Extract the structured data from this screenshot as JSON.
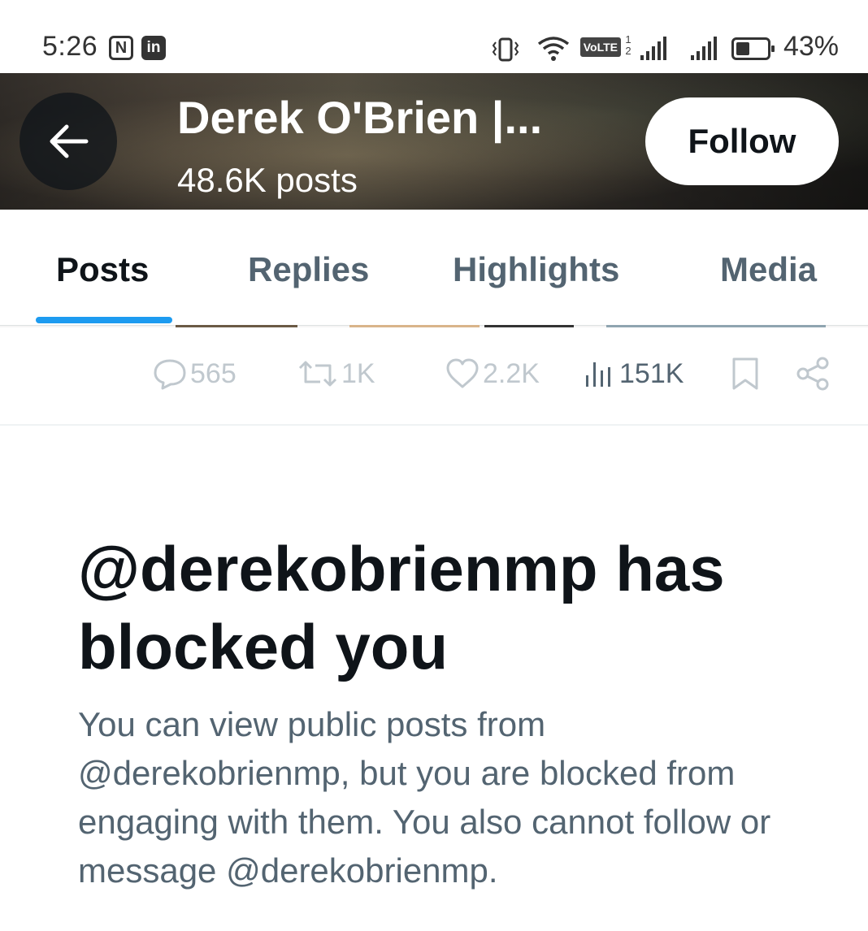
{
  "status_bar": {
    "time": "5:26",
    "nfc_glyph": "N",
    "linkedin_glyph": "in",
    "volte": "VoLTE",
    "sim_index": "1\n2",
    "battery": "43%"
  },
  "header": {
    "title": "Derek O'Brien |...",
    "subtitle": "48.6K posts",
    "follow_label": "Follow"
  },
  "tabs": [
    {
      "label": "Posts",
      "active": true
    },
    {
      "label": "Replies",
      "active": false
    },
    {
      "label": "Highlights",
      "active": false
    },
    {
      "label": "Media",
      "active": false
    }
  ],
  "actions": {
    "replies": "565",
    "reposts": "1K",
    "likes": "2.2K",
    "views": "151K"
  },
  "blocked": {
    "title": "@derekobrienmp has blocked you",
    "description": "You can view public posts from @derekobrienmp, but you are blocked from engaging with them. You also cannot follow or message @derekobrienmp."
  },
  "colors": {
    "accent": "#1d9bf0",
    "text_primary": "#0f1419",
    "text_secondary": "#536471",
    "icon_muted": "#c0c8ce"
  },
  "icons": [
    "back-arrow-icon",
    "reply-icon",
    "repost-icon",
    "like-icon",
    "views-icon",
    "bookmark-icon",
    "share-icon"
  ]
}
